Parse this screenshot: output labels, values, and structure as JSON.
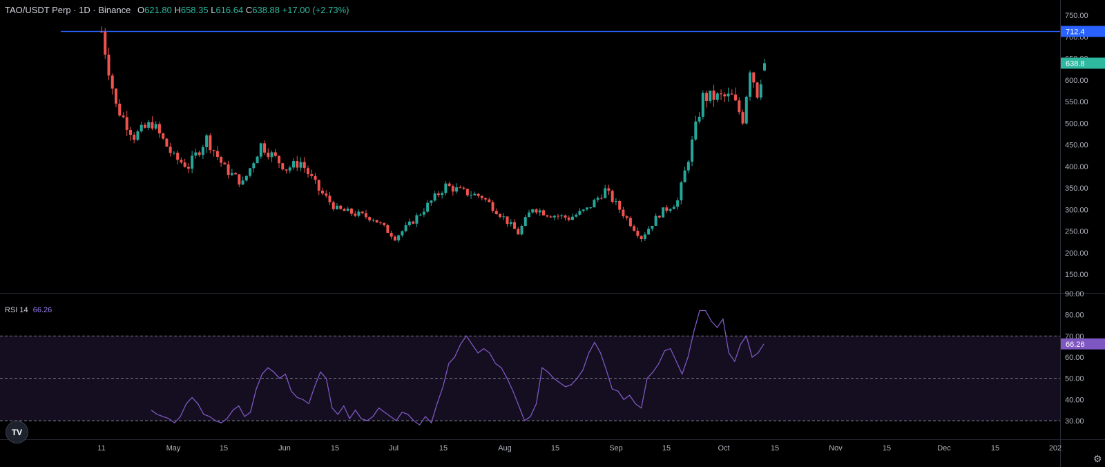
{
  "legend": {
    "symbol": "TAO/USDT Perp · 1D · Binance",
    "o_label": "O",
    "o": "621.80",
    "h_label": "H",
    "h": "658.35",
    "l_label": "L",
    "l": "616.64",
    "c_label": "C",
    "c": "638.88",
    "change": "+17.00 (+2.73%)"
  },
  "rsi_legend": {
    "name": "RSI 14",
    "value": "66.26"
  },
  "logo_text": "TV",
  "icons": {
    "settings": "gear-icon",
    "logo": "tradingview-logo"
  },
  "colors": {
    "up": "#26a69a",
    "down": "#ef5350",
    "level": "#2962ff",
    "rsi": "#7e57c2",
    "price_tag": "#2fb8a0"
  },
  "chart_data": [
    {
      "type": "candlestick",
      "title": "TAO/USDT Perp · 1D · Binance",
      "ylim": [
        125,
        775
      ],
      "y_ticks": [
        "750.00",
        "700.00",
        "650.00",
        "600.00",
        "550.00",
        "500.00",
        "450.00",
        "400.00",
        "350.00",
        "300.00",
        "250.00",
        "200.00",
        "150.00"
      ],
      "x_ticks": [
        "11",
        "May",
        "15",
        "Jun",
        "15",
        "Jul",
        "15",
        "Aug",
        "15",
        "Sep",
        "15",
        "Oct",
        "15",
        "Nov",
        "15",
        "Dec",
        "15",
        "202"
      ],
      "price_line": {
        "value": 712.4,
        "label": "712.4"
      },
      "last_price_label": "638.8",
      "approx_closes": [
        {
          "date": "Apr 11",
          "close": 712
        },
        {
          "date": "Apr 15",
          "close": 540
        },
        {
          "date": "Apr 20",
          "close": 470
        },
        {
          "date": "Apr 25",
          "close": 500
        },
        {
          "date": "May 1",
          "close": 420
        },
        {
          "date": "May 5",
          "close": 400
        },
        {
          "date": "May 10",
          "close": 465
        },
        {
          "date": "May 15",
          "close": 395
        },
        {
          "date": "May 20",
          "close": 360
        },
        {
          "date": "May 25",
          "close": 450
        },
        {
          "date": "Jun 1",
          "close": 395
        },
        {
          "date": "Jun 5",
          "close": 410
        },
        {
          "date": "Jun 10",
          "close": 345
        },
        {
          "date": "Jun 15",
          "close": 300
        },
        {
          "date": "Jun 20",
          "close": 290
        },
        {
          "date": "Jun 25",
          "close": 280
        },
        {
          "date": "Jul 1",
          "close": 235
        },
        {
          "date": "Jul 5",
          "close": 265
        },
        {
          "date": "Jul 10",
          "close": 310
        },
        {
          "date": "Jul 15",
          "close": 355
        },
        {
          "date": "Jul 20",
          "close": 340
        },
        {
          "date": "Jul 25",
          "close": 330
        },
        {
          "date": "Jul 30",
          "close": 290
        },
        {
          "date": "Aug 4",
          "close": 245
        },
        {
          "date": "Aug 8",
          "close": 305
        },
        {
          "date": "Aug 12",
          "close": 290
        },
        {
          "date": "Aug 18",
          "close": 280
        },
        {
          "date": "Aug 23",
          "close": 300
        },
        {
          "date": "Aug 28",
          "close": 345
        },
        {
          "date": "Sep 2",
          "close": 290
        },
        {
          "date": "Sep 7",
          "close": 235
        },
        {
          "date": "Sep 12",
          "close": 290
        },
        {
          "date": "Sep 17",
          "close": 320
        },
        {
          "date": "Sep 20",
          "close": 420
        },
        {
          "date": "Sep 24",
          "close": 560
        },
        {
          "date": "Sep 28",
          "close": 560
        },
        {
          "date": "Oct 2",
          "close": 560
        },
        {
          "date": "Oct 5",
          "close": 510
        },
        {
          "date": "Oct 7",
          "close": 630
        },
        {
          "date": "Oct 9",
          "close": 570
        },
        {
          "date": "Oct 11",
          "close": 638.88
        }
      ]
    },
    {
      "type": "line",
      "title": "RSI 14",
      "ylim": [
        25,
        90
      ],
      "y_ticks": [
        "90.00",
        "80.00",
        "70.00",
        "60.00",
        "50.00",
        "40.00",
        "30.00"
      ],
      "bands": [
        70,
        50,
        30
      ],
      "last_value_label": "66.26",
      "series": [
        {
          "name": "RSI 14",
          "values": [
            35,
            33,
            32,
            31,
            29,
            32,
            38,
            41,
            38,
            33,
            32,
            30,
            29,
            31,
            35,
            37,
            32,
            34,
            45,
            52,
            55,
            53,
            50,
            52,
            44,
            41,
            40,
            38,
            46,
            53,
            50,
            36,
            33,
            37,
            31,
            35,
            31,
            30,
            32,
            36,
            34,
            32,
            30,
            34,
            33,
            30,
            28,
            32,
            29,
            38,
            46,
            57,
            60,
            66,
            70,
            66,
            62,
            64,
            62,
            57,
            55,
            50,
            44,
            37,
            30,
            32,
            38,
            55,
            53,
            50,
            48,
            46,
            47,
            50,
            54,
            62,
            67,
            62,
            54,
            45,
            44,
            40,
            42,
            38,
            36,
            50,
            53,
            57,
            63,
            64,
            58,
            52,
            60,
            72,
            82,
            82,
            77,
            74,
            78,
            62,
            58,
            66,
            70,
            60,
            62,
            66.26
          ]
        }
      ]
    }
  ]
}
